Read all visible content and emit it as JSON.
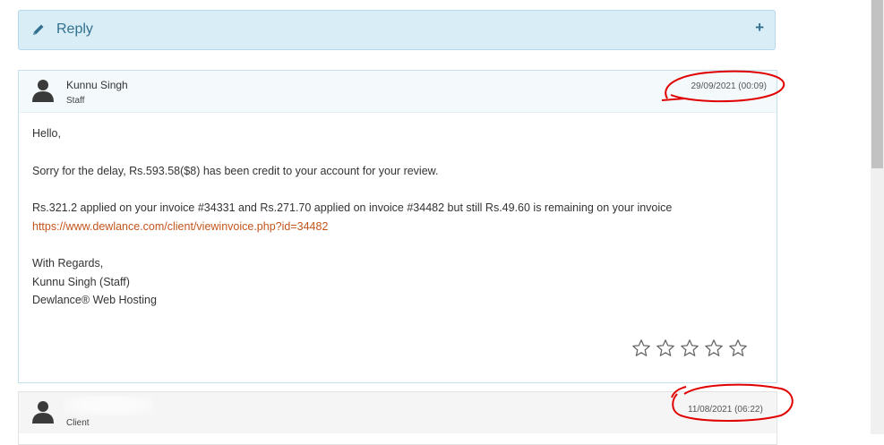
{
  "reply": {
    "label": "Reply",
    "toggle": "+"
  },
  "messages": [
    {
      "name": "Kunnu Singh",
      "role": "Staff",
      "date": "29/09/2021 (00:09)",
      "lines": [
        "Hello,",
        "Sorry for the delay, Rs.593.58($8) has been credit to your account for your review.",
        "Rs.321.2 applied on your invoice #34331 and Rs.271.70 applied on invoice #34482 but still Rs.49.60 is remaining on your invoice",
        "https://www.dewlance.com/client/viewinvoice.php?id=34482",
        "With Regards,",
        "Kunnu Singh (Staff)",
        "Dewlance® Web Hosting"
      ],
      "rating": {
        "value": 0,
        "max": 5
      }
    },
    {
      "name": "",
      "role": "Client",
      "date": "11/08/2021 (06:22)"
    }
  ],
  "colors": {
    "reply_bg": "#d9edf7",
    "reply_text": "#31708f",
    "link": "#c3551c",
    "annotation": "#e00000"
  },
  "icons": {
    "reply": "pencil-icon",
    "toggle": "plus-icon",
    "avatar": "user-icon",
    "rating": "star-icon"
  }
}
